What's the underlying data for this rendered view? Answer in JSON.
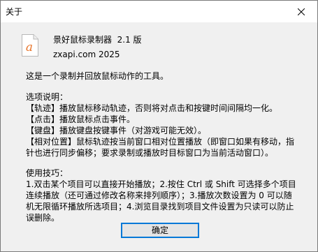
{
  "window": {
    "title": "关于"
  },
  "app": {
    "icon_letter": "a",
    "name_version": "景好鼠标录制器  2.1 版",
    "site_year": "zxapi.com 2025"
  },
  "content": {
    "intro": "这是一个录制并回放鼠标动作的工具。",
    "options_heading": "选项说明：",
    "options": [
      "【轨迹】播放鼠标移动轨迹，否则将对点击和按键时间间隔均一化。",
      "【点击】播放鼠标点击事件。",
      "【键盘】播放键盘按键事件（对游戏可能无效）。",
      "【相对位置】鼠标轨迹按当前窗口相对位置播放（即窗口如果有移动，指",
      "针也进行同步偏移；要求录制或播放时目标窗口为当前活动窗口）。"
    ],
    "tips_heading": "使用技巧：",
    "tips": [
      "1.双击某个项目可以直接开始播放；2.按住 Ctrl 或 Shift 可选择多个项目",
      "连续播放（还可通过修改名称来排列顺序）；3.播放次数设置为 0 可以随",
      "机无限循环播放所选项目；4.浏览目录找到项目文件设置为只读可以防止",
      "误删除。"
    ]
  },
  "buttons": {
    "ok_label": "确定"
  },
  "colors": {
    "icon_letter": "#e8742a",
    "button_focus_border": "#0078d7"
  }
}
